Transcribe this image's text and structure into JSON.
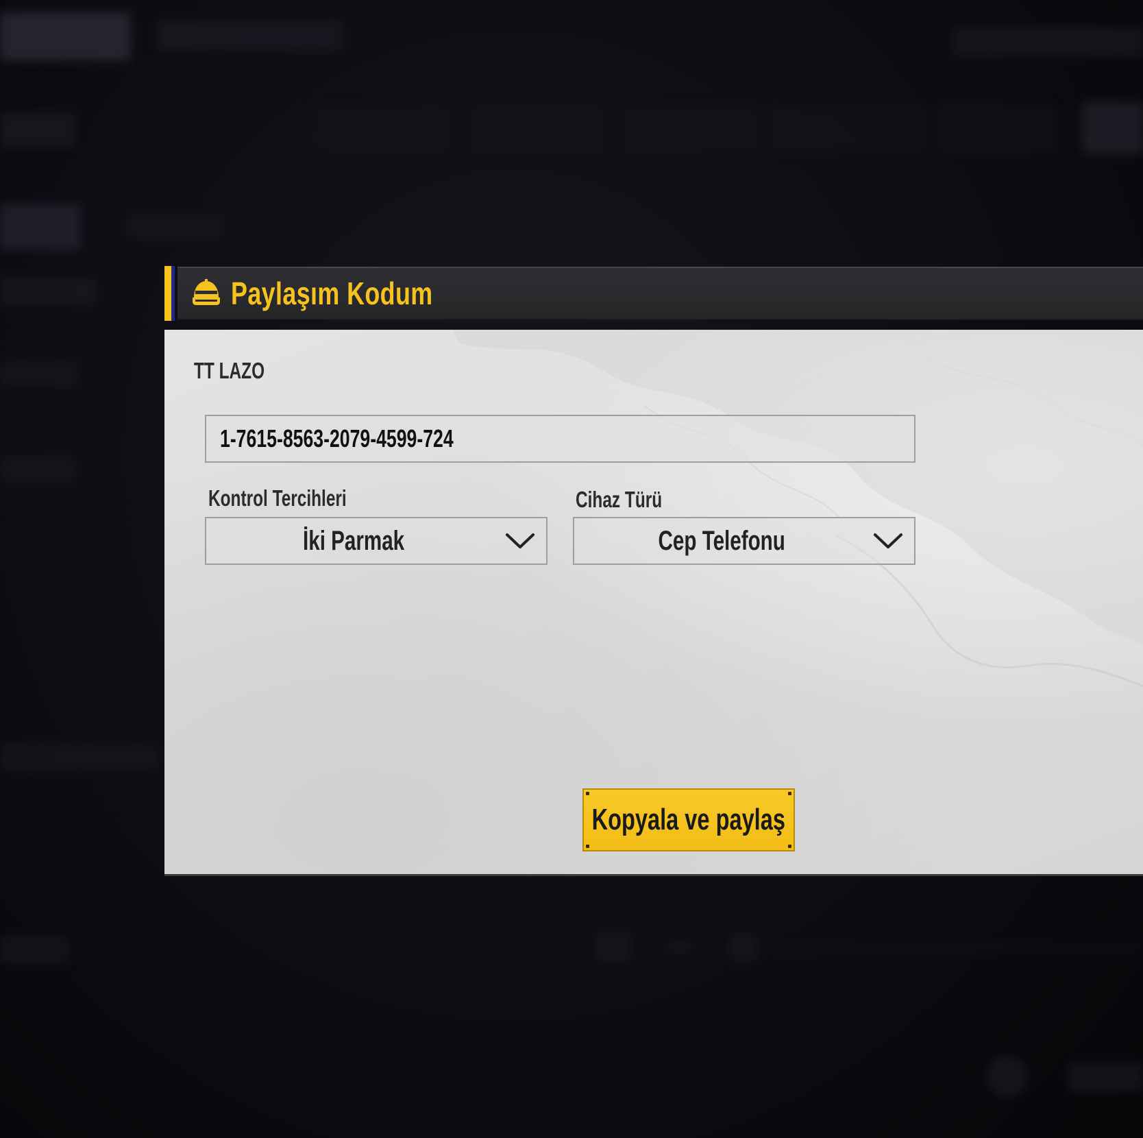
{
  "dialog": {
    "title": "Paylaşım Kodum",
    "player_name": "TT LAZO",
    "share_code": "1-7615-8563-2079-4599-724",
    "control_pref": {
      "label": "Kontrol Tercihleri",
      "value": "İki Parmak"
    },
    "device_type": {
      "label": "Cihaz Türü",
      "value": "Cep Telefonu"
    },
    "copy_button_label": "Kopyala ve paylaş",
    "icon": "helmet-icon"
  },
  "colors": {
    "accent": "#f6c21f",
    "title_bar": "#2b2b2f",
    "panel": "#dddddd",
    "overlay": "#0b0b0e"
  }
}
